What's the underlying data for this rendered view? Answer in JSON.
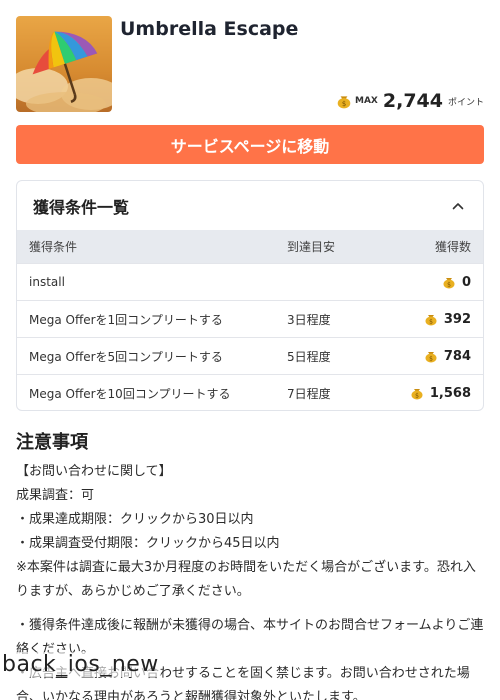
{
  "header": {
    "title": "Umbrella Escape",
    "max_label": "MAX",
    "max_points": "2,744",
    "points_unit": "ポイント",
    "icon_name": "umbrella-app-icon"
  },
  "cta": {
    "label": "サービスページに移動"
  },
  "conditions": {
    "title": "獲得条件一覧",
    "columns": [
      "獲得条件",
      "到達目安",
      "獲得数"
    ],
    "rows": [
      {
        "condition": "install",
        "eta": "",
        "reward": "0"
      },
      {
        "condition": "Mega Offerを1回コンプリートする",
        "eta": "3日程度",
        "reward": "392"
      },
      {
        "condition": "Mega Offerを5回コンプリートする",
        "eta": "5日程度",
        "reward": "784"
      },
      {
        "condition": "Mega Offerを10回コンプリートする",
        "eta": "7日程度",
        "reward": "1,568"
      }
    ]
  },
  "notes": {
    "title": "注意事項",
    "lines": [
      "【お問い合わせに関して】",
      "成果調査：可",
      "・成果達成期限：クリックから30日以内",
      "・成果調査受付期限：クリックから45日以内",
      "※本案件は調査に最大3か月程度のお時間をいただく場合がございます。恐れ入りますが、あらかじめご了承ください。",
      "・獲得条件達成後に報酬が未獲得の場合、本サイトのお問合せフォームよりご連絡ください。",
      "・広告主へ直接お問い合わせすることを固く禁じます。お問い合わせされた場合、いかなる理由があろうと報酬獲得対象外といたします。"
    ]
  },
  "overlay": {
    "label": "back_ios_new"
  },
  "colors": {
    "accent": "#ff7348",
    "table_header": "#e7eaef",
    "coin": "#e9b021"
  }
}
